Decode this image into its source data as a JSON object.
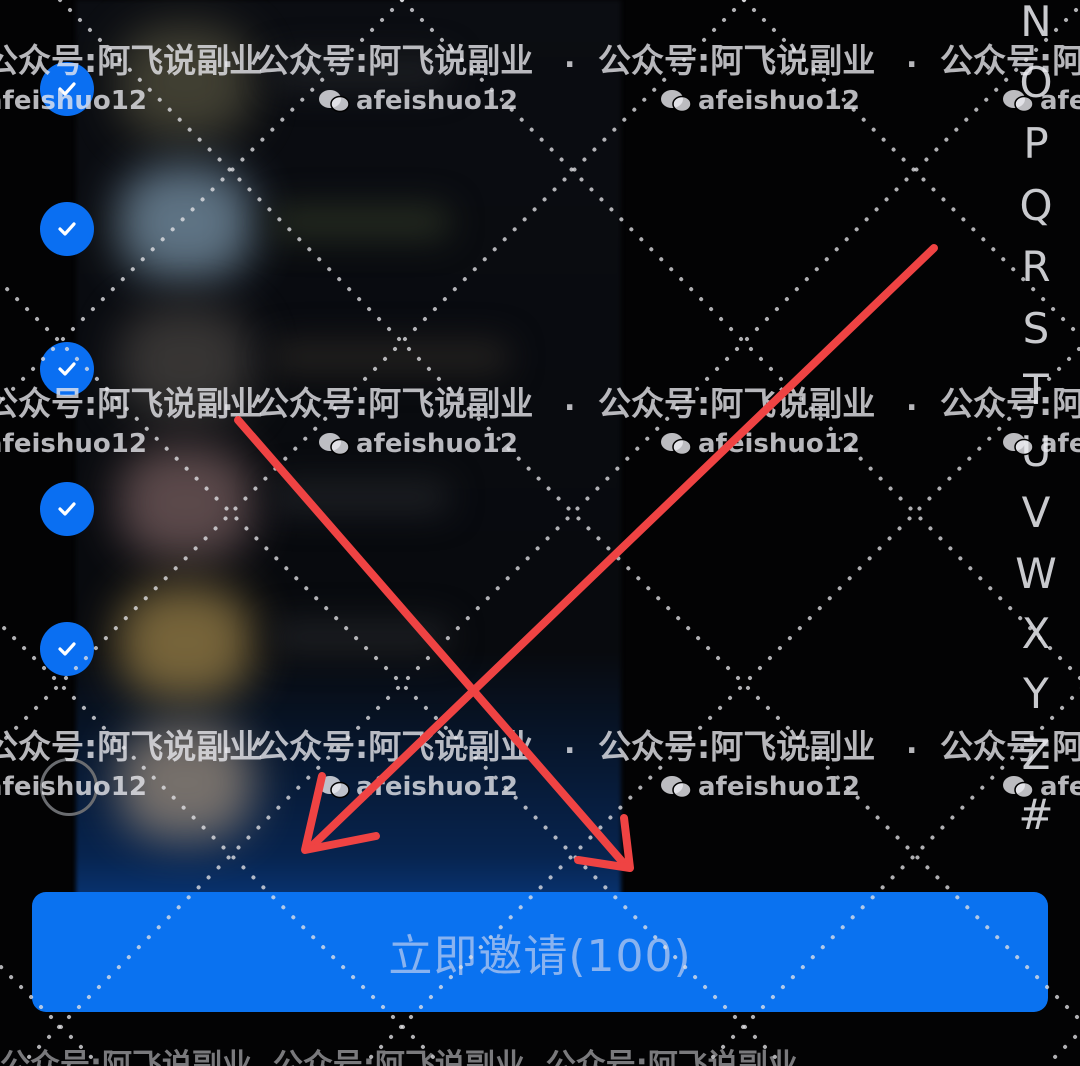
{
  "index_letters": [
    "N",
    "O",
    "P",
    "Q",
    "R",
    "S",
    "T",
    "U",
    "V",
    "W",
    "X",
    "Y",
    "Z",
    "#"
  ],
  "invite_button": {
    "label": "立即邀请(100)"
  },
  "watermark": {
    "line1": "公众号:阿飞说副业",
    "line2": "afeishuo12",
    "icon": "wechat-icon",
    "separator": "."
  },
  "colors": {
    "accent": "#0a72f0",
    "annotation_arrow": "#ef4343",
    "background": "#030304"
  }
}
